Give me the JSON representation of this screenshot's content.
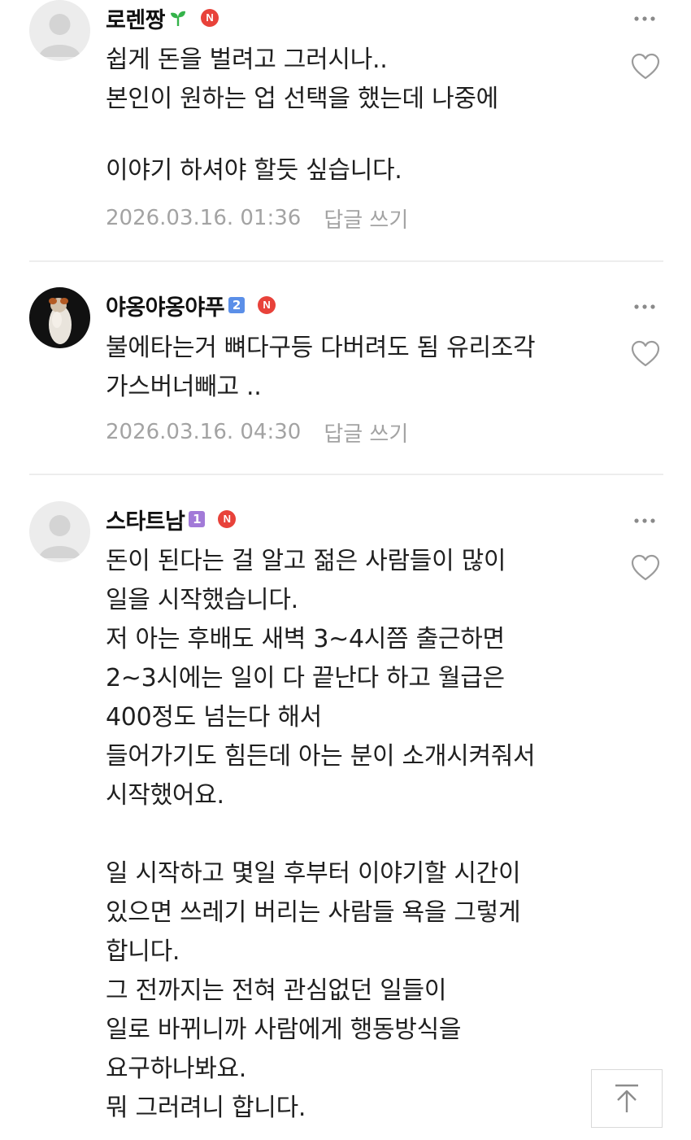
{
  "comments": [
    {
      "author": "로렌짱",
      "author_icon": "sprout-icon",
      "n_badge": "N",
      "text_lines": [
        "쉽게 돈을 벌려고 그러시나..",
        "본인이 원하는 업 선택을 했는데 나중에",
        "",
        "이야기 하셔야 할듯 싶습니다."
      ],
      "date": "2026.03.16. 01:36",
      "reply_label": "답글 쓰기"
    },
    {
      "author": "야옹야옹야푸",
      "level_badge": "2",
      "n_badge": "N",
      "text_lines": [
        "불에타는거 뼈다구등 다버려도 됨 유리조각",
        "가스버너빼고 .."
      ],
      "date": "2026.03.16. 04:30",
      "reply_label": "답글 쓰기"
    },
    {
      "author": "스타트남",
      "level_badge": "1",
      "n_badge": "N",
      "text_lines": [
        "돈이 된다는 걸 알고 젊은 사람들이 많이",
        "일을 시작했습니다.",
        "저 아는 후배도 새벽 3~4시쯤 출근하면",
        "2~3시에는 일이 다 끝난다 하고 월급은",
        "400정도 넘는다 해서",
        "들어가기도 힘든데 아는 분이 소개시켜줘서",
        "시작했어요.",
        "",
        "일 시작하고 몇일 후부터 이야기할 시간이",
        "있으면 쓰레기 버리는 사람들 욕을 그렇게",
        "합니다.",
        "그 전까지는 전혀 관심없던 일들이",
        "일로 바뀌니까 사람에게 행동방식을",
        "요구하나봐요.",
        "뭐 그러려니 합니다."
      ]
    }
  ],
  "colors": {
    "n_badge": "#e8423a",
    "level_2": "#5b8fe8",
    "level_1": "#a27ad8",
    "sprout": "#35b34a",
    "meta_text": "#a3a3a3",
    "divider": "#ededed"
  },
  "icons": {
    "more": "more-dots-icon",
    "like": "heart-outline-icon",
    "scroll_top": "arrow-up-icon"
  }
}
